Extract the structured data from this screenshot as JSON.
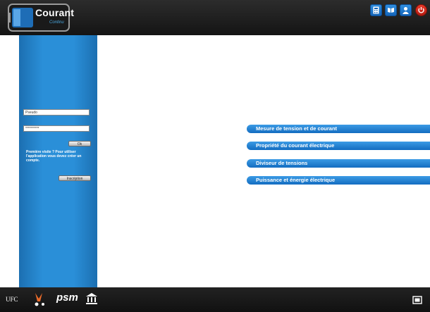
{
  "app": {
    "title": "Courant",
    "subtitle": "Continu"
  },
  "top_icons": [
    "calculator-icon",
    "book-icon",
    "user-icon",
    "power-icon"
  ],
  "login": {
    "username_value": "Pseudo",
    "password_value": "**********",
    "ok_label": "Ok",
    "hint": "Première visite ? Pour utiliser l'application vous devez créer un compte.",
    "signup_label": "Inscription"
  },
  "menu": [
    "Mesure de tension et de courant",
    "Propriété du courant électrique",
    "Diviseur de tensions",
    "Puissance et énergie électrique"
  ],
  "footer": {
    "logo1": "UFC",
    "logo3": "psm"
  },
  "colors": {
    "accent": "#2a8fd8",
    "menu": "#1a7bd0",
    "power": "#e0301e"
  }
}
